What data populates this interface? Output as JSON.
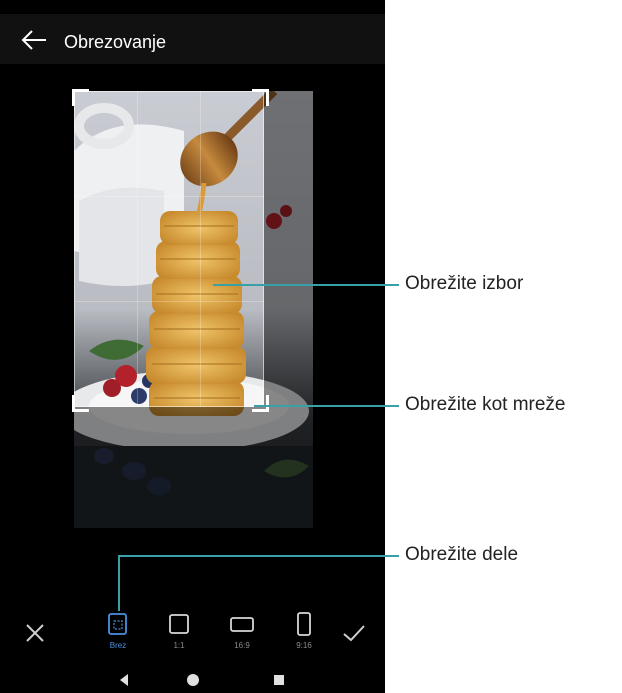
{
  "header": {
    "title": "Obrezovanje",
    "back_icon": "arrow-left-icon"
  },
  "image": {
    "subject": "waffles-with-honey-dipper"
  },
  "toolbar": {
    "close_icon": "close-icon",
    "confirm_icon": "check-icon",
    "tools": [
      {
        "label": "Brez",
        "icon": "crop-free-icon",
        "active": true
      },
      {
        "label": "1:1",
        "icon": "ratio-square-icon",
        "active": false
      },
      {
        "label": "16:9",
        "icon": "ratio-landscape-icon",
        "active": false
      },
      {
        "label": "9:16",
        "icon": "ratio-portrait-icon",
        "active": false
      }
    ]
  },
  "nav": {
    "back": "nav-back-icon",
    "home": "nav-home-icon",
    "recent": "nav-recent-icon"
  },
  "callouts": [
    {
      "text": "Obrežite izbor"
    },
    {
      "text": "Obrežite kot mreže"
    },
    {
      "text": "Obrežite dele"
    }
  ],
  "colors": {
    "accent": "#4a90e2",
    "callout_line": "#3aa0a8",
    "background": "#000000"
  }
}
